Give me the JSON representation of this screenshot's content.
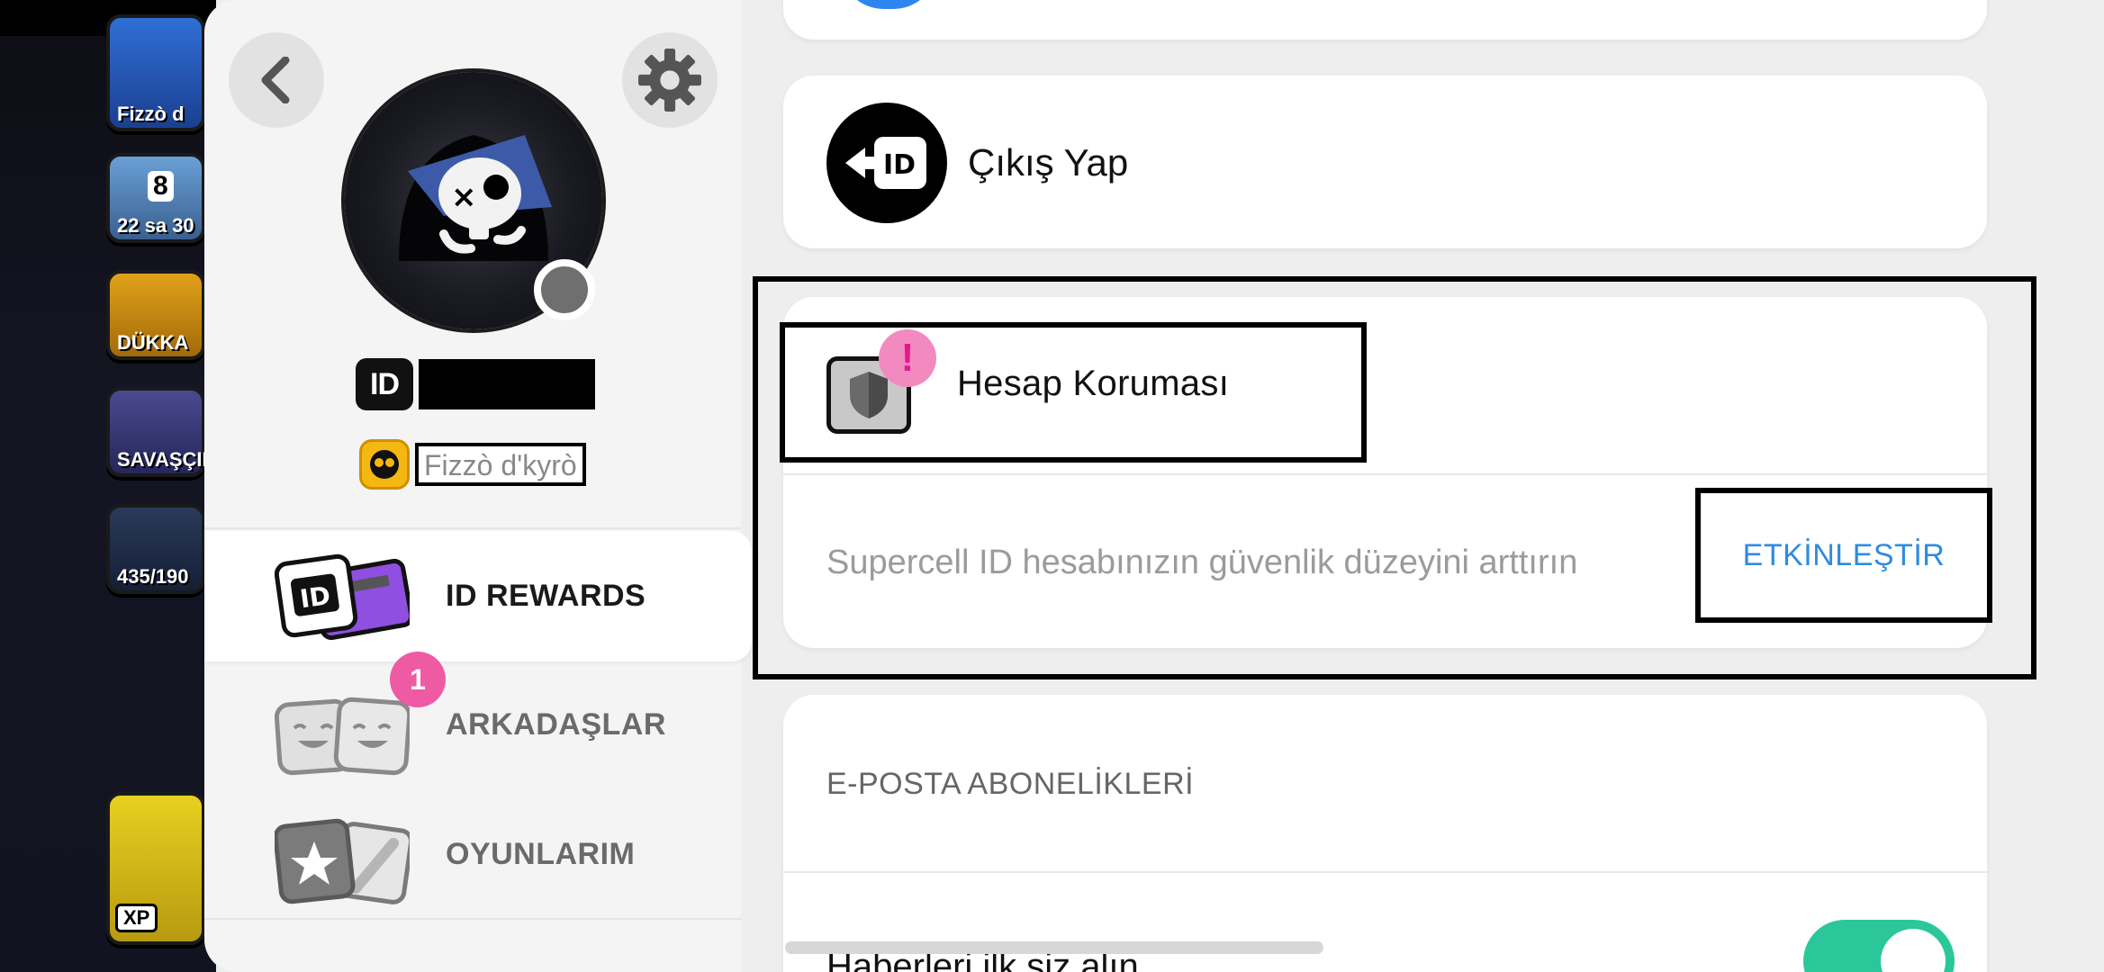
{
  "background_game": {
    "tiles": [
      {
        "label": "Fizzò d"
      },
      {
        "label": "22 sa 30"
      },
      {
        "label": "DÜKKA"
      },
      {
        "label": "SAVAŞÇIL"
      },
      {
        "label": "435/190"
      },
      {
        "label": "XP"
      }
    ],
    "event_badge_number": "8"
  },
  "sidebar": {
    "id_chip": "ID",
    "player_name": "Fizzò d'kyrò",
    "menu": [
      {
        "label": "ID REWARDS",
        "active": true,
        "icon": "id-rewards-cards-icon"
      },
      {
        "label": "ARKADAŞLAR",
        "active": false,
        "icon": "friends-faces-icon",
        "badge": "1"
      },
      {
        "label": "OYUNLARIM",
        "active": false,
        "icon": "my-games-cards-icon"
      }
    ]
  },
  "logout": {
    "label": "Çıkış Yap",
    "icon_text": "ID"
  },
  "protection": {
    "title": "Hesap Koruması",
    "alert": "!",
    "description": "Supercell ID hesabınızın güvenlik düzeyini arttırın",
    "action": "ETKİNLEŞTİR"
  },
  "email": {
    "title": "E-POSTA ABONELİKLERİ",
    "news_label": "Haberleri ilk siz alın",
    "news_toggle_on": true
  },
  "colors": {
    "accent_blue": "#2f8be0",
    "badge_pink": "#ef5aa5",
    "toggle_green": "#2bc79a"
  }
}
